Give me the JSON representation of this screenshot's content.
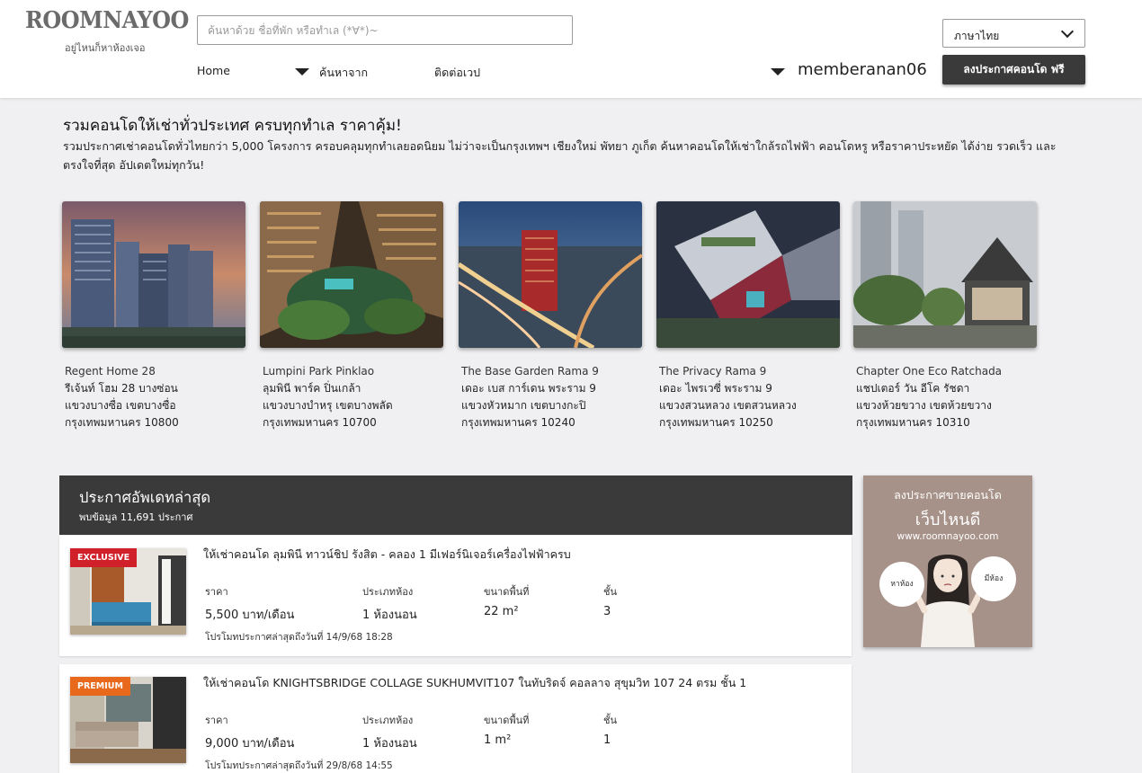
{
  "brand": {
    "logo": "ROOMNAYOO",
    "tagline": "อยู่ไหนก็หาห้องเจอ"
  },
  "search": {
    "placeholder": "ค้นหาด้วย ชื่อที่พัก หรือทำเล (*∀*)~"
  },
  "nav": {
    "home": "Home",
    "search_from": "ค้นหาจาก",
    "contact": "ติดต่อเวป"
  },
  "user": {
    "name": "memberanan06"
  },
  "language": {
    "selected": "ภาษาไทย"
  },
  "post_button": "ลงประกาศคอนโด ฟรี",
  "intro": {
    "title": "รวมคอนโดให้เช่าทั่วประเทศ ครบทุกทำเล ราคาคุ้ม!",
    "description": "รวมประกาศเช่าคอนโดทั่วไทยกว่า 5,000 โครงการ ครอบคลุมทุกทำเลยอดนิยม ไม่ว่าจะเป็นกรุงเทพฯ เชียงใหม่ พัทยา ภูเก็ต ค้นหาคอนโดให้เช่าใกล้รถไฟฟ้า คอนโดหรู หรือราคาประหยัด ได้ง่าย รวดเร็ว และตรงใจที่สุด อัปเดตใหม่ทุกวัน!"
  },
  "projects": [
    {
      "name_en": "Regent Home 28",
      "name_th": "รีเจ้นท์ โฮม 28 บางซ่อน",
      "district": "แขวงบางซื่อ เขตบางซื่อ",
      "city": "กรุงเทพมหานคร 10800"
    },
    {
      "name_en": "Lumpini Park Pinklao",
      "name_th": "ลุมพินี พาร์ค ปิ่นเกล้า",
      "district": "แขวงบางบำหรุ เขตบางพลัด",
      "city": "กรุงเทพมหานคร 10700"
    },
    {
      "name_en": "The Base Garden Rama 9",
      "name_th": "เดอะ เบส การ์เดน พระราม 9",
      "district": "แขวงหัวหมาก เขตบางกะปิ",
      "city": "กรุงเทพมหานคร 10240"
    },
    {
      "name_en": "The Privacy Rama 9",
      "name_th": "เดอะ ไพรเวซี่ พระราม 9",
      "district": "แขวงสวนหลวง เขตสวนหลวง",
      "city": "กรุงเทพมหานคร 10250"
    },
    {
      "name_en": "Chapter One Eco Ratchada",
      "name_th": "แชปเตอร์ วัน อีโค รัชดา",
      "district": "แขวงห้วยขวาง เขตห้วยขวาง",
      "city": "กรุงเทพมหานคร 10310"
    }
  ],
  "listings_header": {
    "title": "ประกาศอัพเดทล่าสุด",
    "count": "พบข้อมูล 11,691 ประกาศ"
  },
  "listing_labels": {
    "price": "ราคา",
    "room_type": "ประเภทห้อง",
    "area": "ขนาดพื้นที่",
    "floor": "ชั้น"
  },
  "listings": [
    {
      "badge": "EXCLUSIVE",
      "badge_color": "#d0202a",
      "title": "ให้เช่าคอนโด ลุมพินี ทาวน์ชิป รังสิต - คลอง 1 มีเฟอร์นิเจอร์เครื่องไฟฟ้าครบ",
      "price": "5,500 บาท/เดือน",
      "room_type": "1 ห้องนอน",
      "area": "22 m²",
      "floor": "3",
      "promo": "โปรโมทประกาศล่าสุดถึงวันที่ 14/9/68 18:28"
    },
    {
      "badge": "PREMIUM",
      "badge_color": "#e8691c",
      "title": "ให้เช่าคอนโด KNIGHTSBRIDGE COLLAGE SUKHUMVIT107 ในทับริดจ์ คอลลาจ สุขุมวิท 107 24 ตรม ชั้น 1",
      "price": "9,000 บาท/เดือน",
      "room_type": "1 ห้องนอน",
      "area": "1 m²",
      "floor": "1",
      "promo": "โปรโมทประกาศล่าสุดถึงวันที่ 29/8/68 14:55"
    }
  ],
  "ad": {
    "line1": "ลงประกาศขายคอนโด",
    "line2": "เว็บไหนดี",
    "url": "www.roomnayoo.com",
    "bubble_left": "หาห้อง",
    "bubble_right": "มีห้อง"
  }
}
